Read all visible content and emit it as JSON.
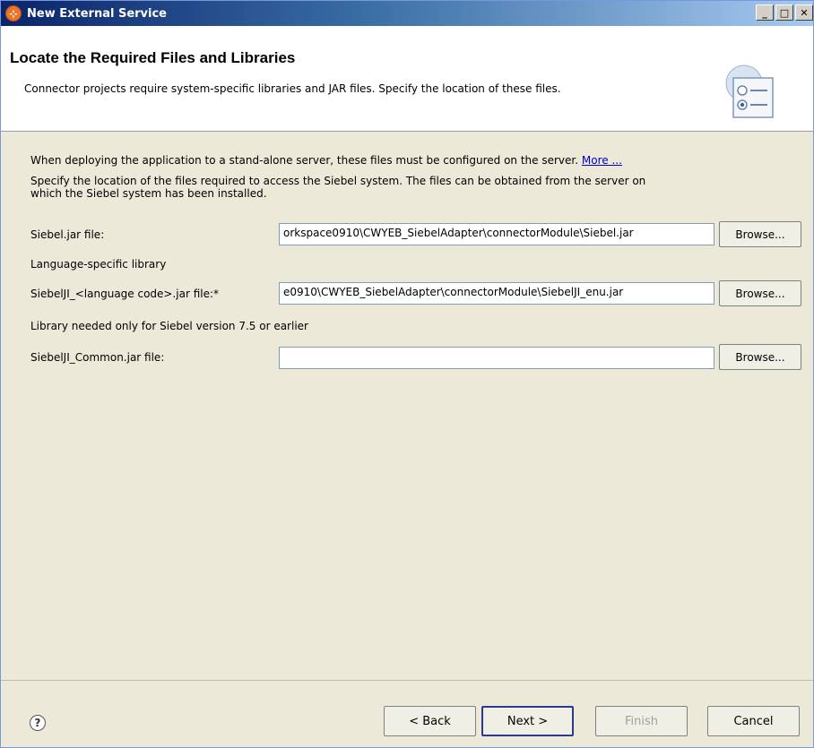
{
  "window": {
    "title": "New External Service",
    "controls": [
      "_",
      "□",
      "✕"
    ]
  },
  "header": {
    "title": "Locate the Required Files and Libraries",
    "description": "Connector projects require system-specific libraries and JAR files. Specify the location of these files.",
    "icon": "radio-list-icon"
  },
  "body": {
    "deploy_note": "When deploying the application to a stand-alone server, these files must be configured on the server.",
    "more_link": "More ...",
    "specify_line1": "Specify the location of the files required to access the Siebel system. The files can be obtained from the server on",
    "specify_line2": "which the Siebel system has been installed.",
    "siebel_jar": {
      "label": "Siebel.jar file:",
      "value": "orkspace0910\\CWYEB_SiebelAdapter\\connectorModule\\Siebel.jar",
      "browse": "Browse..."
    },
    "lang_section": "Language-specific library",
    "siebeljil_jar": {
      "label": "SiebelJI_<language code>.jar file:*",
      "value": "e0910\\CWYEB_SiebelAdapter\\connectorModule\\SiebelJI_enu.jar",
      "browse": "Browse..."
    },
    "legacy_section": "Library needed only for Siebel version 7.5 or earlier",
    "common_jar": {
      "label": "SiebelJI_Common.jar file:",
      "value": "",
      "browse": "Browse..."
    }
  },
  "footer": {
    "help": "?",
    "back": "< Back",
    "next": "Next >",
    "finish": "Finish",
    "cancel": "Cancel"
  }
}
